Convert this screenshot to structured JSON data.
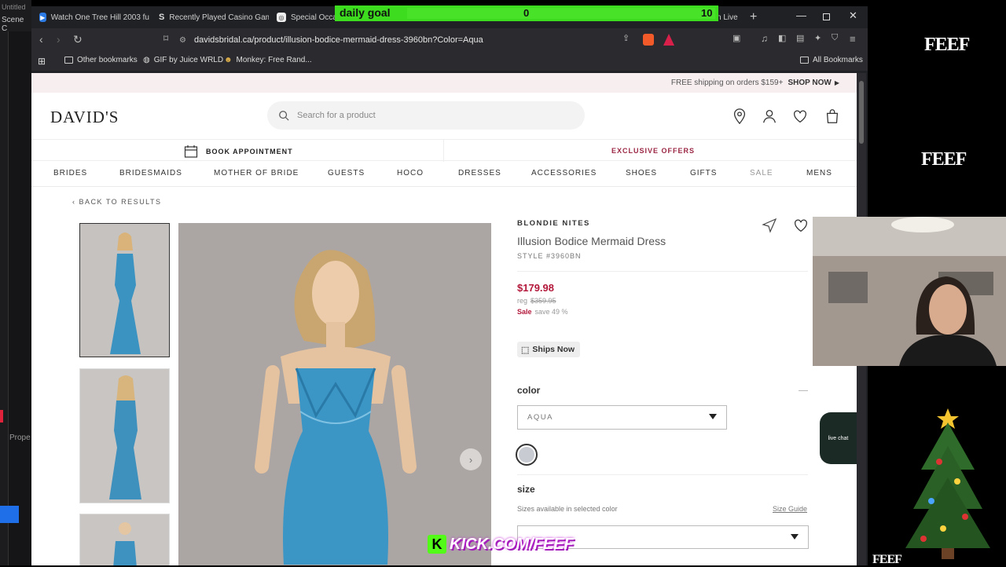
{
  "desktop": {
    "window_title": "Untitled",
    "scene_label": "Scene C",
    "props_label": "Prope"
  },
  "tabs": [
    {
      "title": "Watch One Tree Hill 2003 fu"
    },
    {
      "title": "Recently Played Casino Gam"
    },
    {
      "title": "Special Occas"
    }
  ],
  "partial_tab_text": "n Live",
  "url": "davidsbridal.ca/product/illusion-bodice-mermaid-dress-3960bn?Color=Aqua",
  "bookmarks": [
    "Other bookmarks",
    "GIF by Juice WRLD",
    "Monkey: Free Rand...",
    "All Bookmarks"
  ],
  "goal": {
    "label": "daily goal",
    "current": "0",
    "target": "10",
    "progress": 0
  },
  "site": {
    "promo": "FREE shipping on orders $159+",
    "promo_link": "SHOP NOW",
    "logo": "DAVID'S",
    "search_placeholder": "Search for a product",
    "book_appointment": "BOOK APPOINTMENT",
    "exclusive_offers": "EXCLUSIVE OFFERS",
    "menu": [
      "BRIDES",
      "BRIDESMAIDS",
      "MOTHER OF BRIDE",
      "GUESTS",
      "HOCO",
      "DRESSES",
      "ACCESSORIES",
      "SHOES",
      "GIFTS",
      "SALE",
      "MENS"
    ],
    "back": "BACK TO RESULTS"
  },
  "product": {
    "brand": "BLONDIE NITES",
    "name": "Illusion Bodice Mermaid Dress",
    "style": "STYLE #3960BN",
    "price": "$179.98",
    "reg_label": "reg",
    "reg_price": "$359.95",
    "sale_label": "Sale",
    "save_text": "save 49 %",
    "ships": "Ships Now",
    "color_label": "color",
    "color_value": "AQUA",
    "size_label": "size",
    "size_note": "Sizes available in selected color",
    "size_guide": "Size Guide",
    "live_chat": "live chat"
  },
  "stream": {
    "brand": "FEEF",
    "kick": "KICK.COM/FEEF"
  },
  "colors": {
    "accent": "#b3183b",
    "goal_green": "#3ddc1f",
    "kick_green": "#53fc18"
  }
}
